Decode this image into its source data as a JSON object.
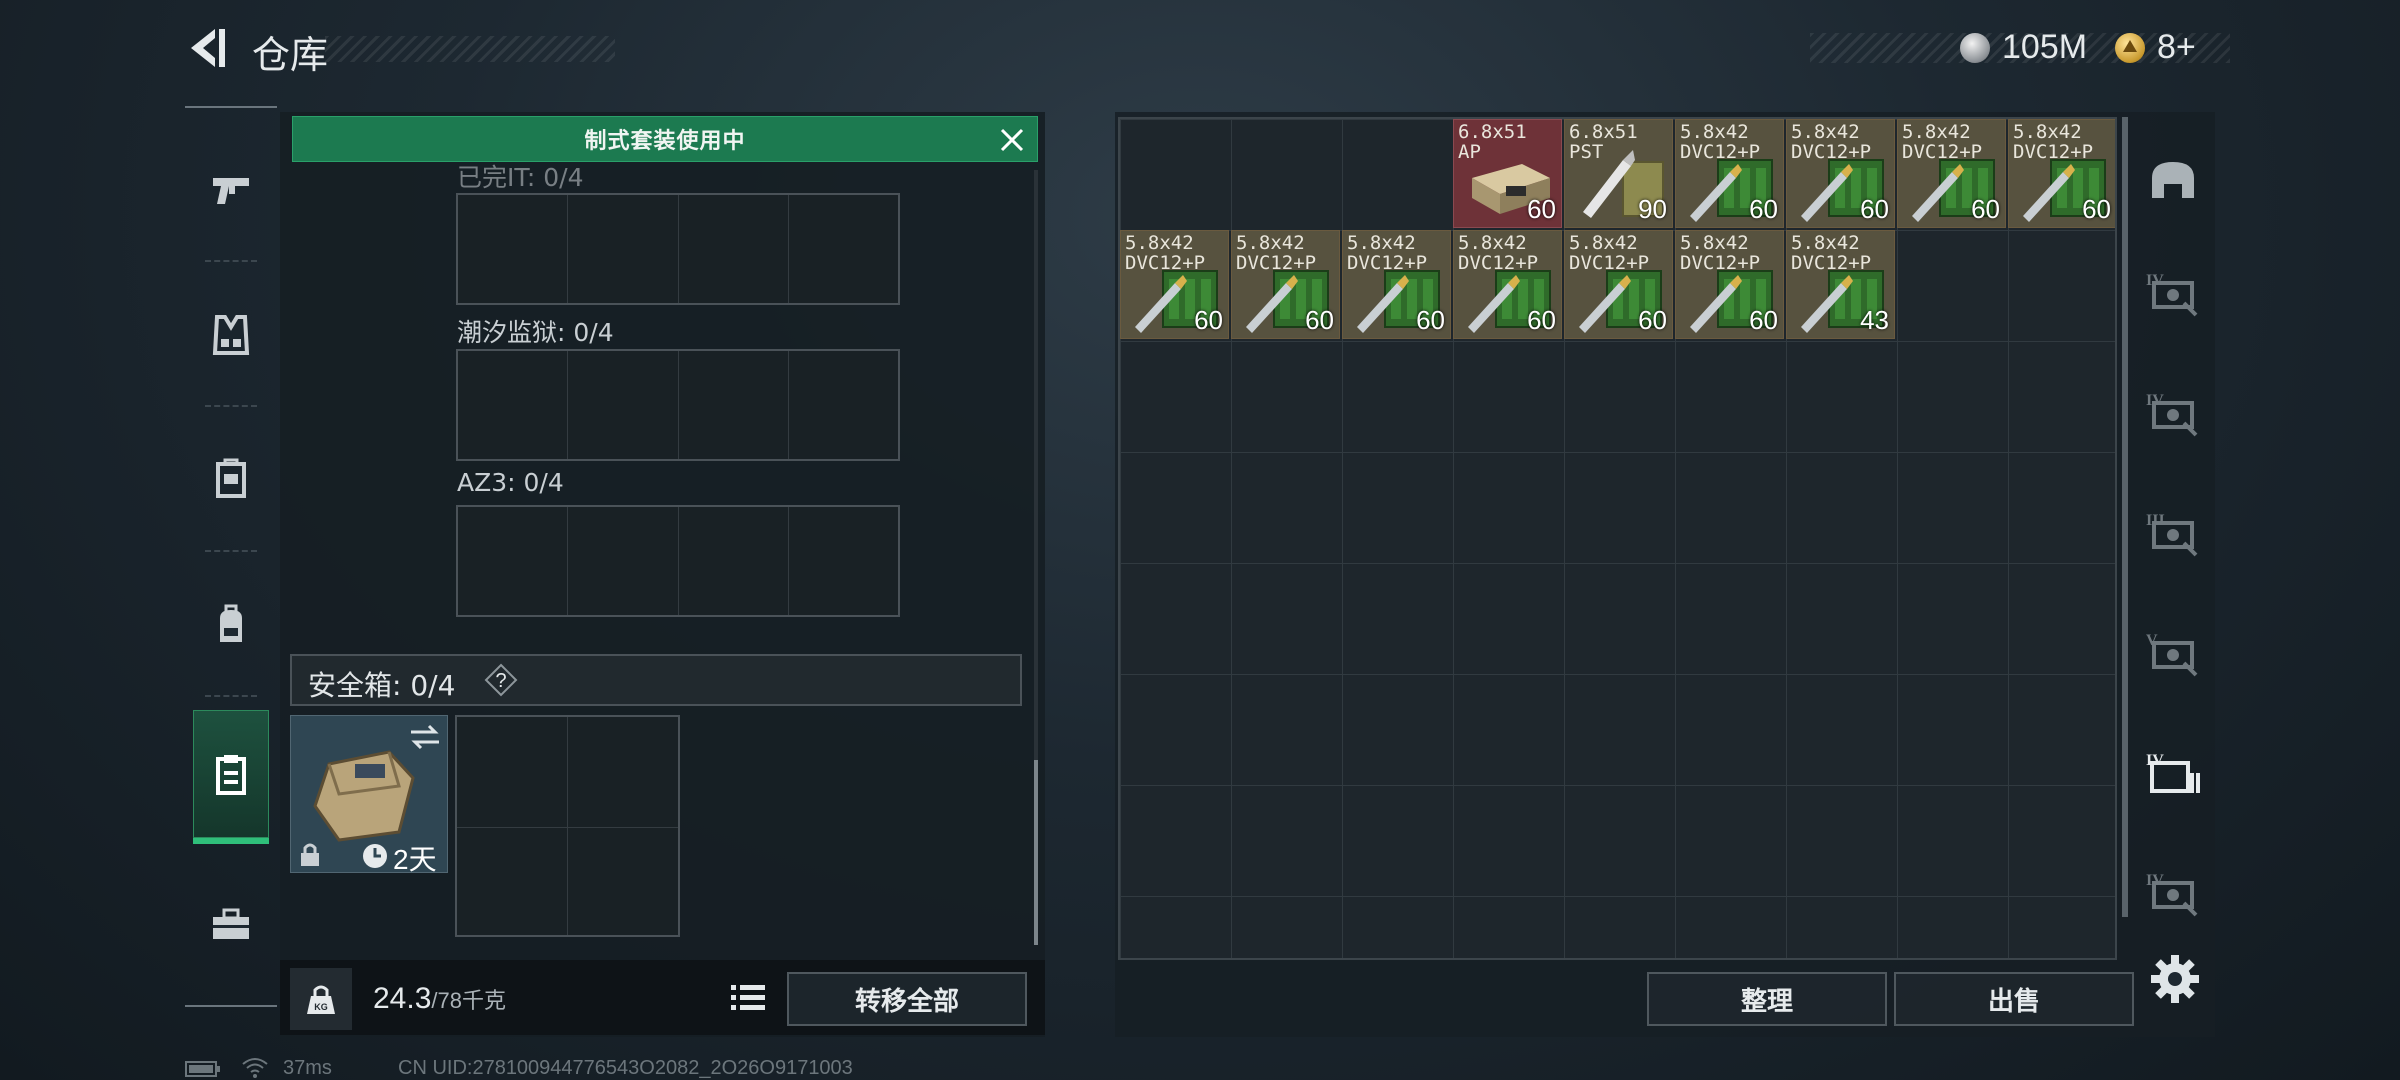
{
  "header": {
    "title": "仓库",
    "money": "105M",
    "gold": "8+"
  },
  "nav": {
    "items": [
      {
        "name": "weapon",
        "icon": "pistol-icon"
      },
      {
        "name": "vest",
        "icon": "vest-icon"
      },
      {
        "name": "armor",
        "icon": "armor-icon"
      },
      {
        "name": "backpack",
        "icon": "backpack-icon"
      },
      {
        "name": "container",
        "icon": "clipboard-icon",
        "active": true
      },
      {
        "name": "toolbox",
        "icon": "toolbox-icon"
      }
    ]
  },
  "loadout": {
    "banner": "制式套装使用中",
    "partial_label": "已完IT: 0/4",
    "section1_label": "潮汐监狱: 0/4",
    "section2_label": "AZ3: 0/4"
  },
  "safebox": {
    "label": "安全箱:  0/4",
    "help": "?",
    "duration": "2天"
  },
  "footer_left": {
    "weight_current": "24.3",
    "weight_max": "/78千克",
    "weight_icon_label": "KG",
    "transfer_all": "转移全部"
  },
  "stash": {
    "items": [
      {
        "name": "6.8x51\nAP",
        "count": "60",
        "kind": "ap"
      },
      {
        "name": "6.8x51\nPST",
        "count": "90",
        "kind": "pst"
      },
      {
        "name": "5.8x42\nDVC12+P",
        "count": "60",
        "kind": "dvc"
      },
      {
        "name": "5.8x42\nDVC12+P",
        "count": "60",
        "kind": "dvc"
      },
      {
        "name": "5.8x42\nDVC12+P",
        "count": "60",
        "kind": "dvc"
      },
      {
        "name": "5.8x42\nDVC12+P",
        "count": "60",
        "kind": "dvc"
      },
      {
        "name": "5.8x42\nDVC12+P",
        "count": "60",
        "kind": "dvc"
      },
      {
        "name": "5.8x42\nDVC12+P",
        "count": "60",
        "kind": "dvc"
      },
      {
        "name": "5.8x42\nDVC12+P",
        "count": "60",
        "kind": "dvc"
      },
      {
        "name": "5.8x42\nDVC12+P",
        "count": "60",
        "kind": "dvc"
      },
      {
        "name": "5.8x42\nDVC12+P",
        "count": "60",
        "kind": "dvc"
      },
      {
        "name": "5.8x42\nDVC12+P",
        "count": "60",
        "kind": "dvc"
      },
      {
        "name": "5.8x42\nDVC12+P",
        "count": "43",
        "kind": "dvc"
      }
    ],
    "sort": "整理",
    "sell": "出售"
  },
  "tools": [
    {
      "icon": "helmet-icon"
    },
    {
      "icon": "armor-iv-icon",
      "tier": "IV"
    },
    {
      "icon": "armor-iv-icon",
      "tier": "IV"
    },
    {
      "icon": "armor-iii-icon",
      "tier": "III"
    },
    {
      "icon": "armor-v-icon",
      "tier": "V"
    },
    {
      "icon": "folder-iv-icon",
      "tier": "IV"
    },
    {
      "icon": "armor-iv-icon",
      "tier": "IV"
    }
  ],
  "status": {
    "ping": "37ms",
    "uid": "CN UID:278100944776543O2082_2O26O9171003"
  }
}
